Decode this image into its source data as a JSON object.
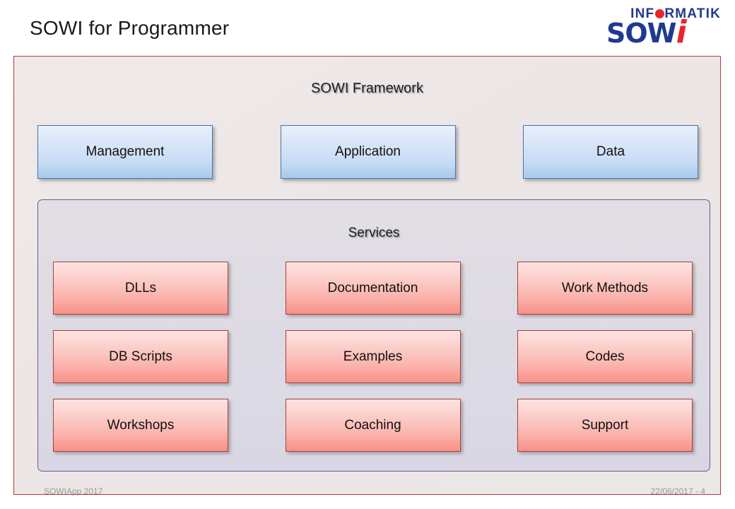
{
  "slide": {
    "title": "SOWI for Programmer"
  },
  "logo": {
    "informatik_pre": "INF",
    "informatik_post": "RMATIK",
    "dot_icon": "red-dot-icon",
    "brand_main": "SOW",
    "brand_accent": "i",
    "brand_blue": "#1f3a8f",
    "brand_red": "#e8252a"
  },
  "framework": {
    "title": "SOWI Framework",
    "border_color": "#b63b3b",
    "layers": [
      {
        "label": "Management"
      },
      {
        "label": "Application"
      },
      {
        "label": "Data"
      }
    ],
    "services": {
      "title": "Services",
      "border_color": "#6b5a8e",
      "rows": [
        [
          {
            "label": "DLLs"
          },
          {
            "label": "Documentation"
          },
          {
            "label": "Work Methods"
          }
        ],
        [
          {
            "label": "DB Scripts"
          },
          {
            "label": "Examples"
          },
          {
            "label": "Codes"
          }
        ],
        [
          {
            "label": "Workshops"
          },
          {
            "label": "Coaching"
          },
          {
            "label": "Support"
          }
        ]
      ]
    }
  },
  "footer": {
    "left": "SOWIApp 2017",
    "right": "22/06/2017 - 4"
  }
}
